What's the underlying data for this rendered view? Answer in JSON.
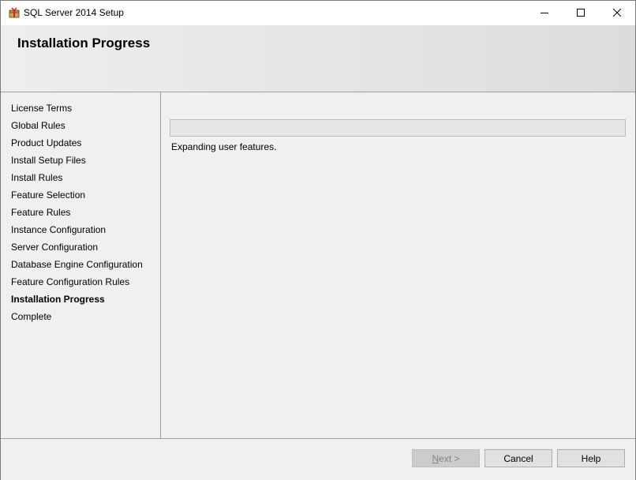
{
  "window": {
    "title": "SQL Server 2014 Setup",
    "icons": {
      "app": "sql-setup-box-icon",
      "minimize": "minimize-icon",
      "maximize": "maximize-icon",
      "close": "close-icon"
    }
  },
  "header": {
    "title": "Installation Progress"
  },
  "nav": {
    "items": [
      {
        "label": "License Terms",
        "active": false
      },
      {
        "label": "Global Rules",
        "active": false
      },
      {
        "label": "Product Updates",
        "active": false
      },
      {
        "label": "Install Setup Files",
        "active": false
      },
      {
        "label": "Install Rules",
        "active": false
      },
      {
        "label": "Feature Selection",
        "active": false
      },
      {
        "label": "Feature Rules",
        "active": false
      },
      {
        "label": "Instance Configuration",
        "active": false
      },
      {
        "label": "Server Configuration",
        "active": false
      },
      {
        "label": "Database Engine Configuration",
        "active": false
      },
      {
        "label": "Feature Configuration Rules",
        "active": false
      },
      {
        "label": "Installation Progress",
        "active": true
      },
      {
        "label": "Complete",
        "active": false
      }
    ]
  },
  "main": {
    "progress_fraction": 0,
    "status_text": "Expanding user features."
  },
  "footer": {
    "next_label": "Next >",
    "cancel_label": "Cancel",
    "help_label": "Help"
  },
  "colors": {
    "header_gradient_start": "#eeeef0",
    "header_gradient_end": "#dcdcde",
    "disabled_text": "#838383"
  }
}
